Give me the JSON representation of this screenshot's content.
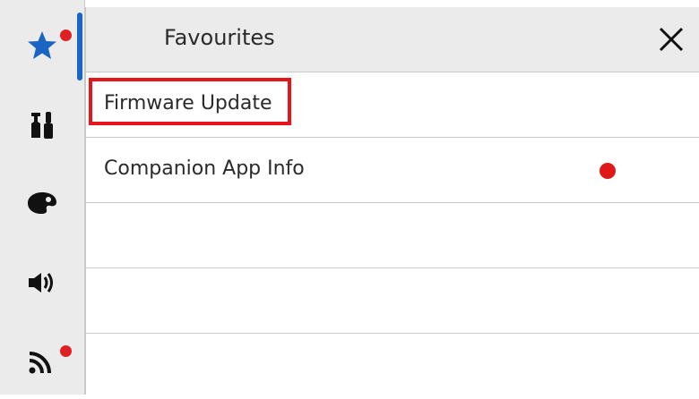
{
  "sidebar": {
    "items": [
      {
        "icon": "star-icon",
        "has_notification": true,
        "active": true
      },
      {
        "icon": "tools-icon",
        "has_notification": false
      },
      {
        "icon": "palette-icon",
        "has_notification": false
      },
      {
        "icon": "speaker-icon",
        "has_notification": false
      },
      {
        "icon": "wifi-signal-icon",
        "has_notification": true
      }
    ],
    "accent_color": "#1a64c4",
    "notification_color": "#e02020"
  },
  "panel": {
    "title": "Favourites",
    "close_icon": "close-icon",
    "rows": [
      {
        "label": "Firmware Update",
        "highlighted": true,
        "has_dot": false
      },
      {
        "label": "Companion App Info",
        "highlighted": false,
        "has_dot": true
      },
      {
        "label": "",
        "highlighted": false,
        "has_dot": false
      },
      {
        "label": "",
        "highlighted": false,
        "has_dot": false
      },
      {
        "label": "",
        "highlighted": false,
        "has_dot": false
      }
    ]
  }
}
